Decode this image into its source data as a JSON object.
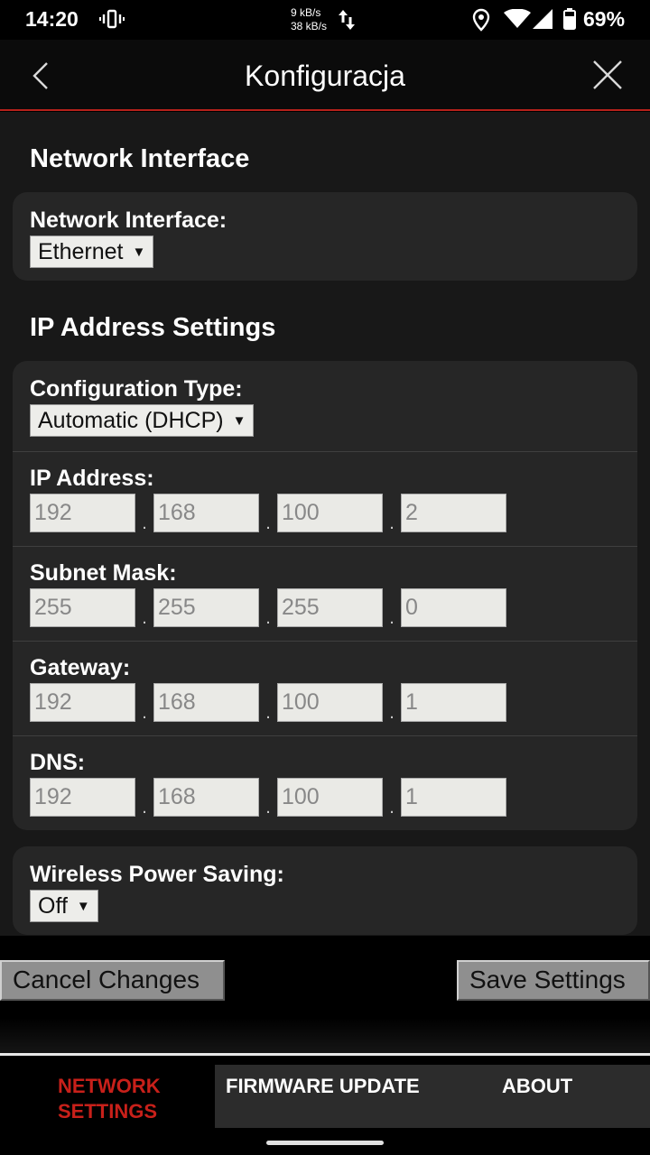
{
  "status_bar": {
    "time": "14:20",
    "rate_up": "9 kB/s",
    "rate_down": "38 kB/s",
    "battery": "69%",
    "icons": [
      "vibrate-icon",
      "data-arrows-icon",
      "location-icon",
      "wifi-icon",
      "cell-signal-icon",
      "battery-icon"
    ]
  },
  "app_bar": {
    "title": "Konfiguracja",
    "accent_color": "#b5211b"
  },
  "network_interface": {
    "section_title": "Network Interface",
    "label": "Network Interface:",
    "value": "Ethernet"
  },
  "ip_settings": {
    "section_title": "IP Address Settings",
    "config_type_label": "Configuration Type:",
    "config_type_value": "Automatic (DHCP)",
    "ip_address": {
      "label": "IP Address:",
      "octets": [
        "192",
        "168",
        "100",
        "2"
      ]
    },
    "subnet_mask": {
      "label": "Subnet Mask:",
      "octets": [
        "255",
        "255",
        "255",
        "0"
      ]
    },
    "gateway": {
      "label": "Gateway:",
      "octets": [
        "192",
        "168",
        "100",
        "1"
      ]
    },
    "dns": {
      "label": "DNS:",
      "octets": [
        "192",
        "168",
        "100",
        "1"
      ]
    }
  },
  "wireless": {
    "label": "Wireless Power Saving:",
    "value": "Off"
  },
  "buttons": {
    "cancel": "Cancel Changes",
    "save": "Save Settings"
  },
  "tabs": {
    "network_line1": "NETWORK",
    "network_line2": "SETTINGS",
    "firmware": "FIRMWARE UPDATE",
    "about": "ABOUT",
    "active_color": "#c8201a"
  }
}
